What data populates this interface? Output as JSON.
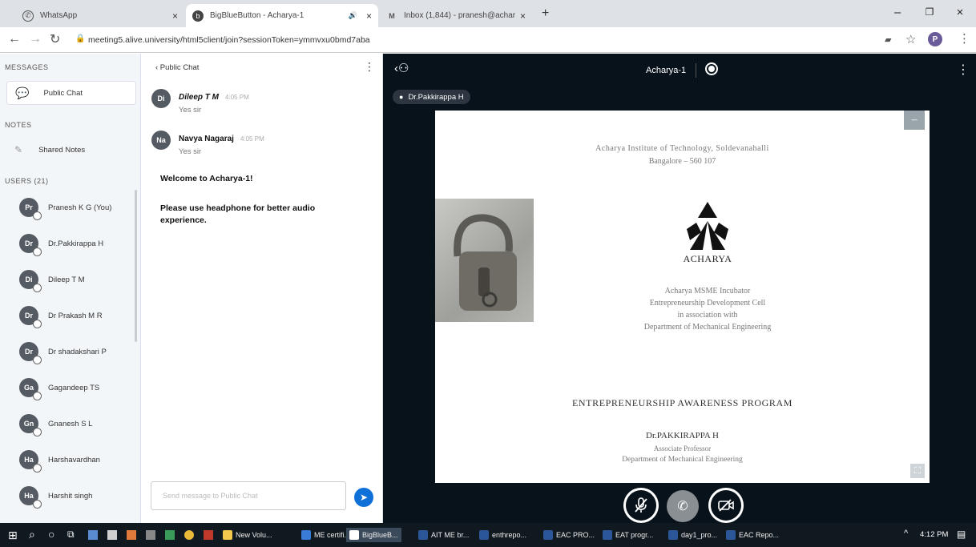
{
  "browser": {
    "tabs": [
      {
        "label": "WhatsApp",
        "icon": "whatsapp-icon"
      },
      {
        "label": "BigBlueButton - Acharya-1",
        "icon": "bbb-icon"
      },
      {
        "label": "Inbox (1,844) - pranesh@achar",
        "icon": "gmail-icon"
      }
    ],
    "new_tab": "+",
    "url": "meeting5.alive.university/html5client/join?sessionToken=ymmvxu0bmd7aba",
    "profile_initial": "P",
    "window_controls": {
      "minimize": "–",
      "maximize": "❐",
      "close": "×"
    }
  },
  "sidebar": {
    "messages_header": "MESSAGES",
    "public_chat_label": "Public Chat",
    "notes_header": "NOTES",
    "shared_notes_label": "Shared Notes",
    "users_header": "USERS (21)",
    "users": [
      {
        "initials": "Pr",
        "name": "Pranesh K G (You)"
      },
      {
        "initials": "Dr",
        "name": "Dr.Pakkirappa H"
      },
      {
        "initials": "Di",
        "name": "Dileep T M"
      },
      {
        "initials": "Dr",
        "name": "Dr Prakash M R"
      },
      {
        "initials": "Dr",
        "name": "Dr shadakshari P"
      },
      {
        "initials": "Ga",
        "name": "Gagandeep TS"
      },
      {
        "initials": "Gn",
        "name": "Gnanesh S L"
      },
      {
        "initials": "Ha",
        "name": "Harshavardhan"
      },
      {
        "initials": "Ha",
        "name": "Harshit singh"
      }
    ]
  },
  "chat": {
    "back_label": "‹  Public Chat",
    "messages": [
      {
        "initials": "Di",
        "name": "Dileep T M",
        "time": "4:05 PM",
        "text": "Yes sir"
      },
      {
        "initials": "Na",
        "name": "Navya Nagaraj",
        "time": "4:05 PM",
        "text": "Yes sir"
      }
    ],
    "welcome": "Welcome to Acharya-1!",
    "notice": "Please use headphone for better audio experience.",
    "input_placeholder": "Send message to Public Chat"
  },
  "meeting": {
    "title": "Acharya-1",
    "presenter": "Dr.Pakkirappa H"
  },
  "slide": {
    "institute": "Acharya Institute of Technology, Soldevanahalli",
    "city": "Bangalore – 560 107",
    "logo_text": "ACHARYA",
    "incubator_lines": [
      "Acharya MSME Incubator",
      "Entrepreneurship Development Cell",
      "in association with",
      "Department of Mechanical Engineering"
    ],
    "program_title": "ENTREPRENEURSHIP AWARENESS PROGRAM",
    "speaker": "Dr.PAKKIRAPPA H",
    "designation": "Associate Professor",
    "department": "Department of Mechanical Engineering"
  },
  "taskbar": {
    "items": [
      "New Volu...",
      "ME certifi...",
      "BigBlueB...",
      "AIT ME br...",
      "enthrepo...",
      "EAC PRO...",
      "EAT progr...",
      "day1_pro...",
      "EAC Repo..."
    ],
    "clock": "4:12 PM"
  },
  "colors": {
    "presentation_bg": "#07121b",
    "accent_blue": "#0f70d7",
    "avatar_gray": "#555b62",
    "taskbar": "#101820"
  }
}
